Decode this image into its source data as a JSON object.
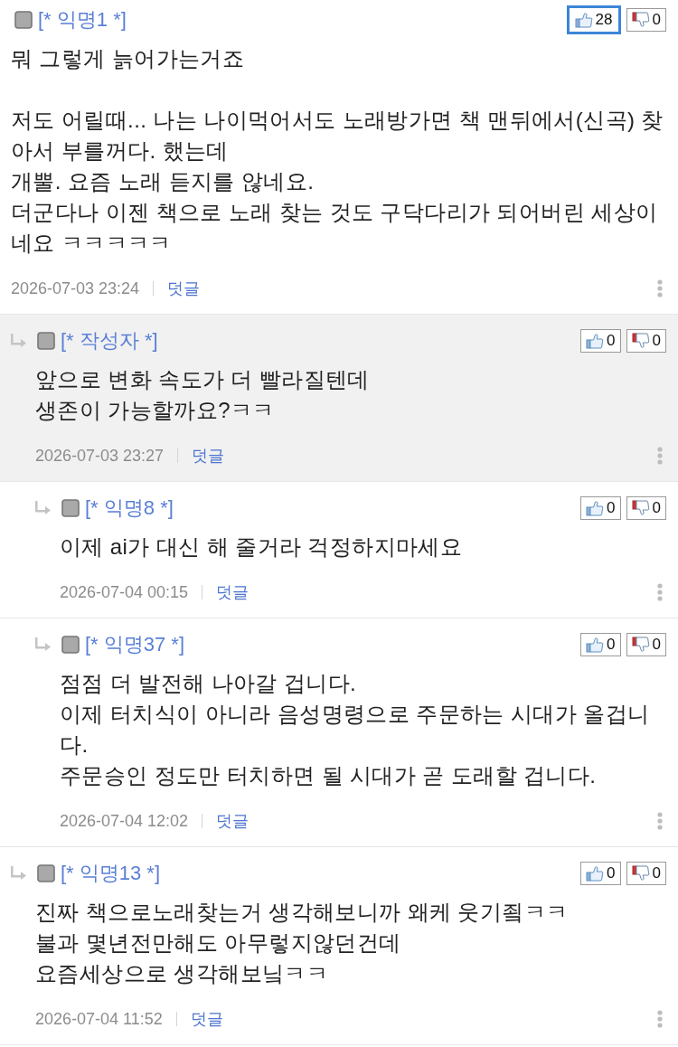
{
  "comments": [
    {
      "author": "[* 익명1 *]",
      "highlighted": false,
      "like": {
        "count": "28",
        "selected": true
      },
      "dislike": {
        "count": "0",
        "selected": false
      },
      "paragraphs": [
        [
          "뭐 그렇게 늙어가는거죠"
        ],
        [
          "저도 어릴때... 나는 나이먹어서도 노래방가면 책 맨뒤에서(신곡) 찾아서 부를꺼다. 했는데",
          "개뿔. 요즘 노래 듣지를 않네요.",
          "더군다나 이젠 책으로 노래 찾는 것도 구닥다리가 되어버린 세상이네요 ㅋㅋㅋㅋㅋ"
        ]
      ],
      "date": "2026-07-03 23:24",
      "reply_link": "덧글",
      "children": [
        {
          "author": "[* 작성자 *]",
          "highlighted": true,
          "like": {
            "count": "0",
            "selected": false
          },
          "dislike": {
            "count": "0",
            "selected": false
          },
          "paragraphs": [
            [
              "앞으로 변화 속도가 더 빨라질텐데",
              "생존이 가능할까요?ㅋㅋ"
            ]
          ],
          "date": "2026-07-03 23:27",
          "reply_link": "덧글",
          "children": [
            {
              "author": "[* 익명8 *]",
              "highlighted": false,
              "like": {
                "count": "0",
                "selected": false
              },
              "dislike": {
                "count": "0",
                "selected": false
              },
              "paragraphs": [
                [
                  "이제 ai가 대신 해 줄거라 걱정하지마세요"
                ]
              ],
              "date": "2026-07-04 00:15",
              "reply_link": "덧글"
            },
            {
              "author": "[* 익명37 *]",
              "highlighted": false,
              "like": {
                "count": "0",
                "selected": false
              },
              "dislike": {
                "count": "0",
                "selected": false
              },
              "paragraphs": [
                [
                  "점점 더 발전해 나아갈 겁니다.",
                  "이제 터치식이 아니라 음성명령으로 주문하는 시대가 올겁니다.",
                  "주문승인 정도만 터치하면 될 시대가 곧 도래할 겁니다."
                ]
              ],
              "date": "2026-07-04 12:02",
              "reply_link": "덧글"
            }
          ]
        },
        {
          "author": "[* 익명13 *]",
          "highlighted": false,
          "like": {
            "count": "0",
            "selected": false
          },
          "dislike": {
            "count": "0",
            "selected": false
          },
          "paragraphs": [
            [
              "진짜 책으로노래찾는거 생각해보니까 왜케 웃기죜ㅋㅋ",
              "불과 몇년전만해도 아무렇지않던건데",
              "요즘세상으로 생각해보닠ㅋㅋ"
            ]
          ],
          "date": "2026-07-04 11:52",
          "reply_link": "덧글"
        }
      ]
    }
  ]
}
